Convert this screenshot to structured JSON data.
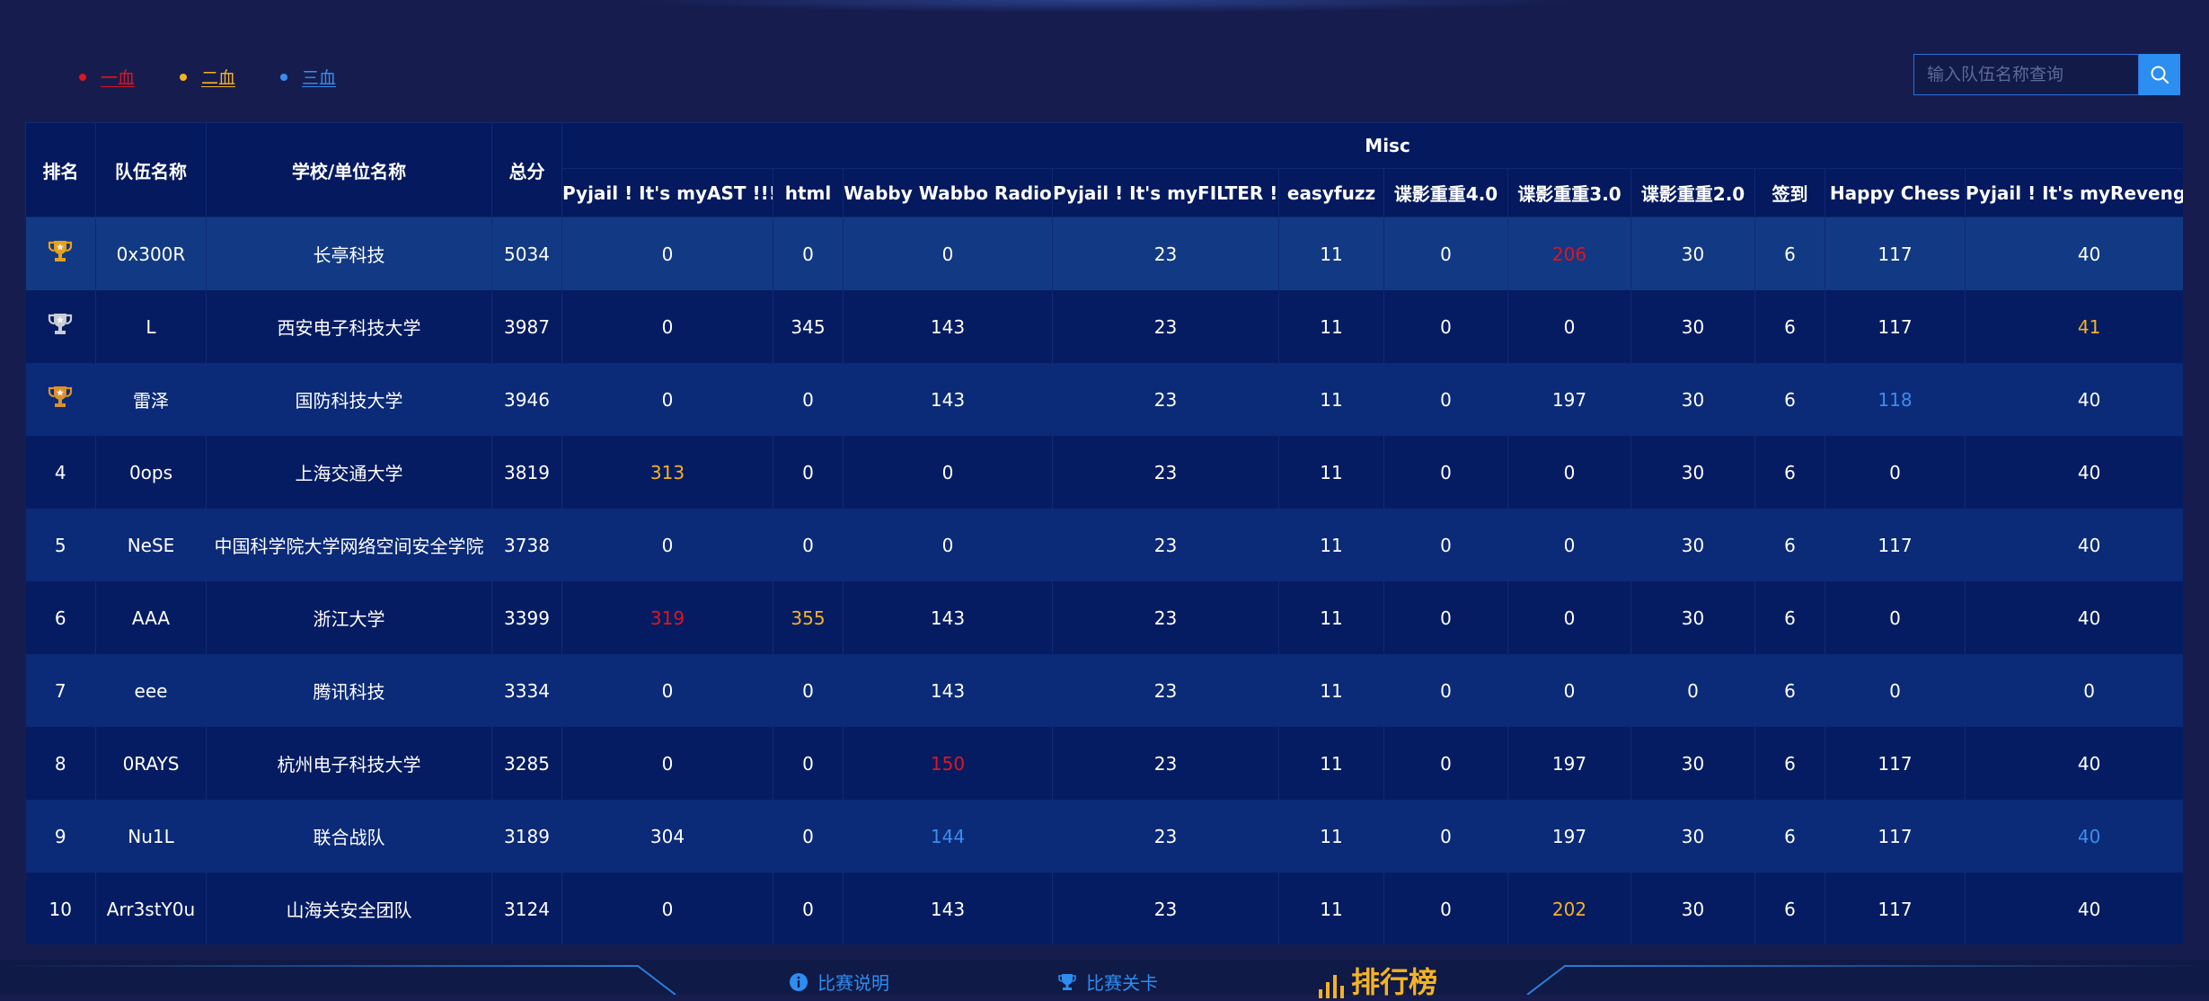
{
  "legend": [
    {
      "label": "一血",
      "color": "#e0141f"
    },
    {
      "label": "二血",
      "color": "#f4b324"
    },
    {
      "label": "三血",
      "color": "#3b8df0"
    }
  ],
  "search": {
    "placeholder": "输入队伍名称查询",
    "icon": "search-icon"
  },
  "table": {
    "group_label": "Misc",
    "fixed_columns": [
      "排名",
      "队伍名称",
      "学校/单位名称",
      "总分"
    ],
    "challenges": [
      "Pyjail ! It's myAST !!!!",
      "html",
      "Wabby Wabbo Radio",
      "Pyjail ! It's myFILTER !!!",
      "easyfuzz",
      "谍影重重4.0",
      "谍影重重3.0",
      "谍影重重2.0",
      "签到",
      "Happy Chess",
      "Pyjail ! It's myRevenge !!!"
    ],
    "rows": [
      {
        "rank": "",
        "trophy": "gold",
        "team": "0x300R",
        "school": "长亭科技",
        "total": "5034",
        "scores": [
          "0",
          "0",
          "0",
          "23",
          "11",
          "0",
          "206",
          "30",
          "6",
          "117",
          "40"
        ],
        "marks": [
          "",
          "",
          "",
          "",
          "",
          "",
          "first",
          "",
          "",
          "",
          ""
        ]
      },
      {
        "rank": "",
        "trophy": "silver",
        "team": "L",
        "school": "西安电子科技大学",
        "total": "3987",
        "scores": [
          "0",
          "345",
          "143",
          "23",
          "11",
          "0",
          "0",
          "30",
          "6",
          "117",
          "41"
        ],
        "marks": [
          "",
          "",
          "",
          "",
          "",
          "",
          "",
          "",
          "",
          "",
          "second"
        ]
      },
      {
        "rank": "",
        "trophy": "bronze",
        "team": "雷泽",
        "school": "国防科技大学",
        "total": "3946",
        "scores": [
          "0",
          "0",
          "143",
          "23",
          "11",
          "0",
          "197",
          "30",
          "6",
          "118",
          "40"
        ],
        "marks": [
          "",
          "",
          "",
          "",
          "",
          "",
          "",
          "",
          "",
          "third",
          ""
        ]
      },
      {
        "rank": "4",
        "trophy": "",
        "team": "0ops",
        "school": "上海交通大学",
        "total": "3819",
        "scores": [
          "313",
          "0",
          "0",
          "23",
          "11",
          "0",
          "0",
          "30",
          "6",
          "0",
          "40"
        ],
        "marks": [
          "second",
          "",
          "",
          "",
          "",
          "",
          "",
          "",
          "",
          "",
          ""
        ]
      },
      {
        "rank": "5",
        "trophy": "",
        "team": "NeSE",
        "school": "中国科学院大学网络空间安全学院",
        "total": "3738",
        "scores": [
          "0",
          "0",
          "0",
          "23",
          "11",
          "0",
          "0",
          "30",
          "6",
          "117",
          "40"
        ],
        "marks": [
          "",
          "",
          "",
          "",
          "",
          "",
          "",
          "",
          "",
          "",
          ""
        ]
      },
      {
        "rank": "6",
        "trophy": "",
        "team": "AAA",
        "school": "浙江大学",
        "total": "3399",
        "scores": [
          "319",
          "355",
          "143",
          "23",
          "11",
          "0",
          "0",
          "30",
          "6",
          "0",
          "40"
        ],
        "marks": [
          "first",
          "second",
          "",
          "",
          "",
          "",
          "",
          "",
          "",
          "",
          ""
        ]
      },
      {
        "rank": "7",
        "trophy": "",
        "team": "eee",
        "school": "腾讯科技",
        "total": "3334",
        "scores": [
          "0",
          "0",
          "143",
          "23",
          "11",
          "0",
          "0",
          "0",
          "6",
          "0",
          "0"
        ],
        "marks": [
          "",
          "",
          "",
          "",
          "",
          "",
          "",
          "",
          "",
          "",
          ""
        ]
      },
      {
        "rank": "8",
        "trophy": "",
        "team": "0RAYS",
        "school": "杭州电子科技大学",
        "total": "3285",
        "scores": [
          "0",
          "0",
          "150",
          "23",
          "11",
          "0",
          "197",
          "30",
          "6",
          "117",
          "40"
        ],
        "marks": [
          "",
          "",
          "first",
          "",
          "",
          "",
          "",
          "",
          "",
          "",
          ""
        ]
      },
      {
        "rank": "9",
        "trophy": "",
        "team": "Nu1L",
        "school": "联合战队",
        "total": "3189",
        "scores": [
          "304",
          "0",
          "144",
          "23",
          "11",
          "0",
          "197",
          "30",
          "6",
          "117",
          "40"
        ],
        "marks": [
          "",
          "",
          "third",
          "",
          "",
          "",
          "",
          "",
          "",
          "",
          "third"
        ]
      },
      {
        "rank": "10",
        "trophy": "",
        "team": "Arr3stY0u",
        "school": "山海关安全团队",
        "total": "3124",
        "scores": [
          "0",
          "0",
          "143",
          "23",
          "11",
          "0",
          "202",
          "30",
          "6",
          "117",
          "40"
        ],
        "marks": [
          "",
          "",
          "",
          "",
          "",
          "",
          "second",
          "",
          "",
          "",
          ""
        ]
      }
    ]
  },
  "mark_colors": {
    "first": "#e0141f",
    "second": "#f4b324",
    "third": "#3b8df0"
  },
  "trophy_colors": {
    "gold": "#e6a020",
    "silver": "#c9ccd6",
    "bronze": "#d9922e"
  },
  "nav": {
    "rules_label": "比赛说明",
    "levels_label": "比赛关卡",
    "title": "排行榜"
  }
}
